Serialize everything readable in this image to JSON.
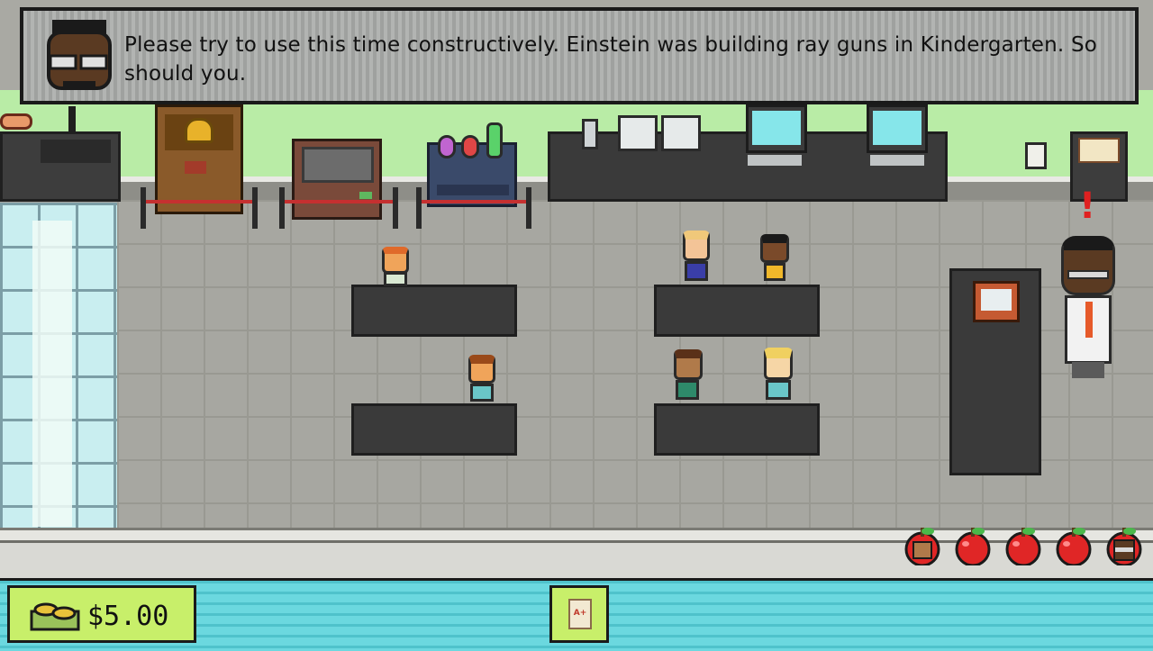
{
  "dialogue": {
    "text": "Please try to use this time constructively. Einstein was building ray guns in Kindergarten. So should you.",
    "speaker_icon": "teacher-portrait-icon"
  },
  "hud": {
    "money": "$5.00",
    "money_icon": "coins-icon",
    "grade_card_label": "A+",
    "grade_card_icon": "report-card-icon",
    "apples": {
      "count": 5,
      "icons": [
        "kid-face-apple-icon",
        "apple-icon",
        "apple-icon",
        "apple-icon",
        "teacher-face-apple-icon"
      ]
    }
  },
  "colors": {
    "wall": "#b9eca6",
    "hud_bar": "#6bd8df",
    "money_box": "#c8ef6a",
    "alert": "#e02020"
  },
  "scene": {
    "teacher_alert": "!"
  }
}
